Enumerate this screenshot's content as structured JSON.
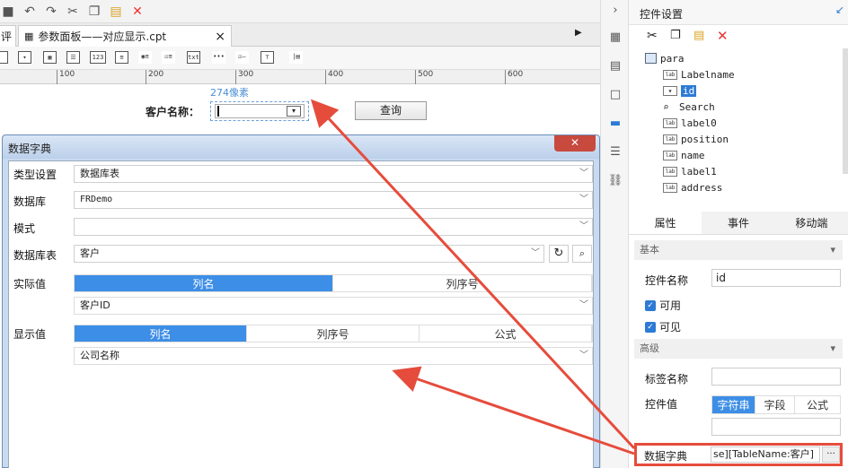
{
  "toolbar": {
    "icons": [
      "save-icon",
      "undo-icon",
      "redo-icon",
      "cut-icon",
      "copy-icon",
      "paste-icon",
      "delete-icon"
    ]
  },
  "tabs": {
    "partial": "评",
    "active": "参数面板——对应显示.cpt",
    "close": "×",
    "pin": "▶"
  },
  "ruler": {
    "ticks": [
      "100",
      "200",
      "300",
      "400",
      "500",
      "600"
    ]
  },
  "canvas": {
    "width_badge": "274像素",
    "customer_label": "客户名称：",
    "query_button": "查询"
  },
  "dialog": {
    "title": "数据字典",
    "rows": {
      "type_label": "类型设置",
      "type_value": "数据库表",
      "db_label": "数据库",
      "db_value": "FRDemo",
      "mode_label": "模式",
      "mode_value": "",
      "table_label": "数据库表",
      "table_value": "客户",
      "actual_label": "实际值",
      "actual_tab1": "列名",
      "actual_tab2": "列序号",
      "actual_value": "客户ID",
      "display_label": "显示值",
      "display_tab1": "列名",
      "display_tab2": "列序号",
      "display_tab3": "公式",
      "display_value": "公司名称"
    }
  },
  "right": {
    "title": "控件设置",
    "tree": [
      {
        "label": "para",
        "icon": "form-icon"
      },
      {
        "label": "Labelname",
        "icon": "label-icon"
      },
      {
        "label": "id",
        "icon": "combo-icon"
      },
      {
        "label": "Search",
        "icon": "search-icon"
      },
      {
        "label": "label0",
        "icon": "label-icon"
      },
      {
        "label": "position",
        "icon": "label-icon"
      },
      {
        "label": "name",
        "icon": "label-icon"
      },
      {
        "label": "label1",
        "icon": "label-icon"
      },
      {
        "label": "address",
        "icon": "label-icon"
      }
    ],
    "prop_tabs": [
      "属性",
      "事件",
      "移动端"
    ],
    "basic": "基本",
    "widget_name_label": "控件名称",
    "widget_name_value": "id",
    "enabled": "可用",
    "visible": "可见",
    "advanced": "高级",
    "tag_name_label": "标签名称",
    "tag_name_value": "",
    "widget_value_label": "控件值",
    "value_tabs": [
      "字符串",
      "字段",
      "公式"
    ],
    "dict_label": "数据字典",
    "dict_value": "se][TableName:客户]",
    "dict_more": "···"
  },
  "colors": {
    "accent": "#3d8ee6",
    "highlight": "#e64c3c"
  }
}
